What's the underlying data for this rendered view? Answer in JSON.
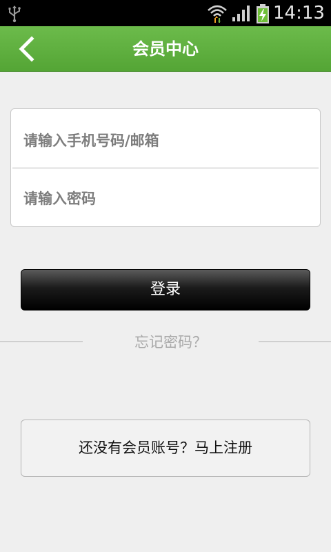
{
  "status_bar": {
    "time": "14:13",
    "icons": [
      "usb-icon",
      "wifi-icon",
      "signal-icon",
      "battery-charging-icon"
    ]
  },
  "header": {
    "title": "会员中心",
    "back_icon": "chevron-left-icon",
    "background_color": "#5aad3a"
  },
  "form": {
    "account_placeholder": "请输入手机号码/邮箱",
    "account_value": "",
    "password_placeholder": "请输入密码",
    "password_value": ""
  },
  "login_button": {
    "label": "登录"
  },
  "forgot_password": {
    "label": "忘记密码？"
  },
  "register_button": {
    "label": "还没有会员账号？马上注册"
  }
}
